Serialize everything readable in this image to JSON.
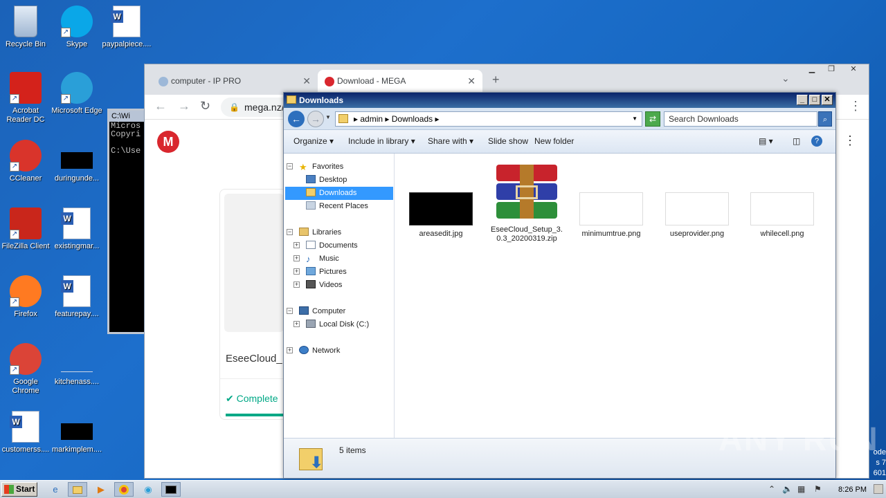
{
  "desktop": {
    "icons": [
      {
        "label": "Recycle Bin",
        "icon": "recycle-bin-icon",
        "color": "#9fb6d2",
        "shortcut": false
      },
      {
        "label": "Skype",
        "icon": "skype-icon",
        "color": "#0aa7e8",
        "shortcut": true
      },
      {
        "label": "paypalpiece....",
        "icon": "word-doc-icon",
        "color": "#2b5fb4",
        "shortcut": false
      },
      {
        "label": "Acrobat Reader DC",
        "icon": "acrobat-icon",
        "color": "#d4221b",
        "shortcut": true
      },
      {
        "label": "Microsoft Edge",
        "icon": "edge-icon",
        "color": "#2a9fd8",
        "shortcut": true
      },
      {
        "label": "CCleaner",
        "icon": "ccleaner-icon",
        "color": "#d9342b",
        "shortcut": true
      },
      {
        "label": "duringunde...",
        "icon": "black-file-icon",
        "color": "#000000",
        "shortcut": false
      },
      {
        "label": "FileZilla Client",
        "icon": "filezilla-icon",
        "color": "#c9261b",
        "shortcut": true
      },
      {
        "label": "existingmar...",
        "icon": "word-doc-icon",
        "color": "#2b5fb4",
        "shortcut": false
      },
      {
        "label": "Firefox",
        "icon": "firefox-icon",
        "color": "#ff7a21",
        "shortcut": true
      },
      {
        "label": "featurepay....",
        "icon": "word-doc-icon",
        "color": "#2b5fb4",
        "shortcut": false
      },
      {
        "label": "Google Chrome",
        "icon": "chrome-icon",
        "color": "#db4437",
        "shortcut": true
      },
      {
        "label": "kitchenass....",
        "icon": "white-file-icon",
        "color": "#ffffff",
        "shortcut": false
      },
      {
        "label": "customerss....",
        "icon": "word-doc-icon",
        "color": "#2b5fb4",
        "shortcut": false
      },
      {
        "label": "markimplem....",
        "icon": "black-file-icon",
        "color": "#000000",
        "shortcut": false
      }
    ],
    "side_text": [
      "ode",
      "s 7",
      "601"
    ],
    "watermark": "ANY RUN"
  },
  "cmd": {
    "title": "C:\\Wi",
    "lines": [
      "Micros",
      "Copyri",
      "",
      "C:\\Use"
    ]
  },
  "chrome": {
    "tabs": [
      {
        "label": "computer - IP PRO",
        "active": false
      },
      {
        "label": "Download - MEGA",
        "active": true
      }
    ],
    "new_tab": "+",
    "url": "mega.nz/",
    "page": {
      "logo": "M",
      "file_name": "EseeCloud_",
      "status": "Complete"
    }
  },
  "explorer": {
    "title": "Downloads",
    "breadcrumb": [
      "admin",
      "Downloads"
    ],
    "search_placeholder": "Search Downloads",
    "commands": [
      "Organize",
      "Include in library",
      "Share with",
      "Slide show",
      "New folder"
    ],
    "nav": {
      "favorites": "Favorites",
      "favorites_items": [
        "Desktop",
        "Downloads",
        "Recent Places"
      ],
      "libraries": "Libraries",
      "libraries_items": [
        "Documents",
        "Music",
        "Pictures",
        "Videos"
      ],
      "computer": "Computer",
      "computer_items": [
        "Local Disk (C:)"
      ],
      "network": "Network"
    },
    "files": [
      {
        "name": "areasedit.jpg",
        "thumb": "black"
      },
      {
        "name": "EseeCloud_Setup_3.0.3_20200319.zip",
        "thumb": "winrar"
      },
      {
        "name": "minimumtrue.png",
        "thumb": "white"
      },
      {
        "name": "useprovider.png",
        "thumb": "white"
      },
      {
        "name": "whilecell.png",
        "thumb": "white"
      }
    ],
    "status": "5 items"
  },
  "taskbar": {
    "start": "Start",
    "clock": "8:26 PM"
  }
}
